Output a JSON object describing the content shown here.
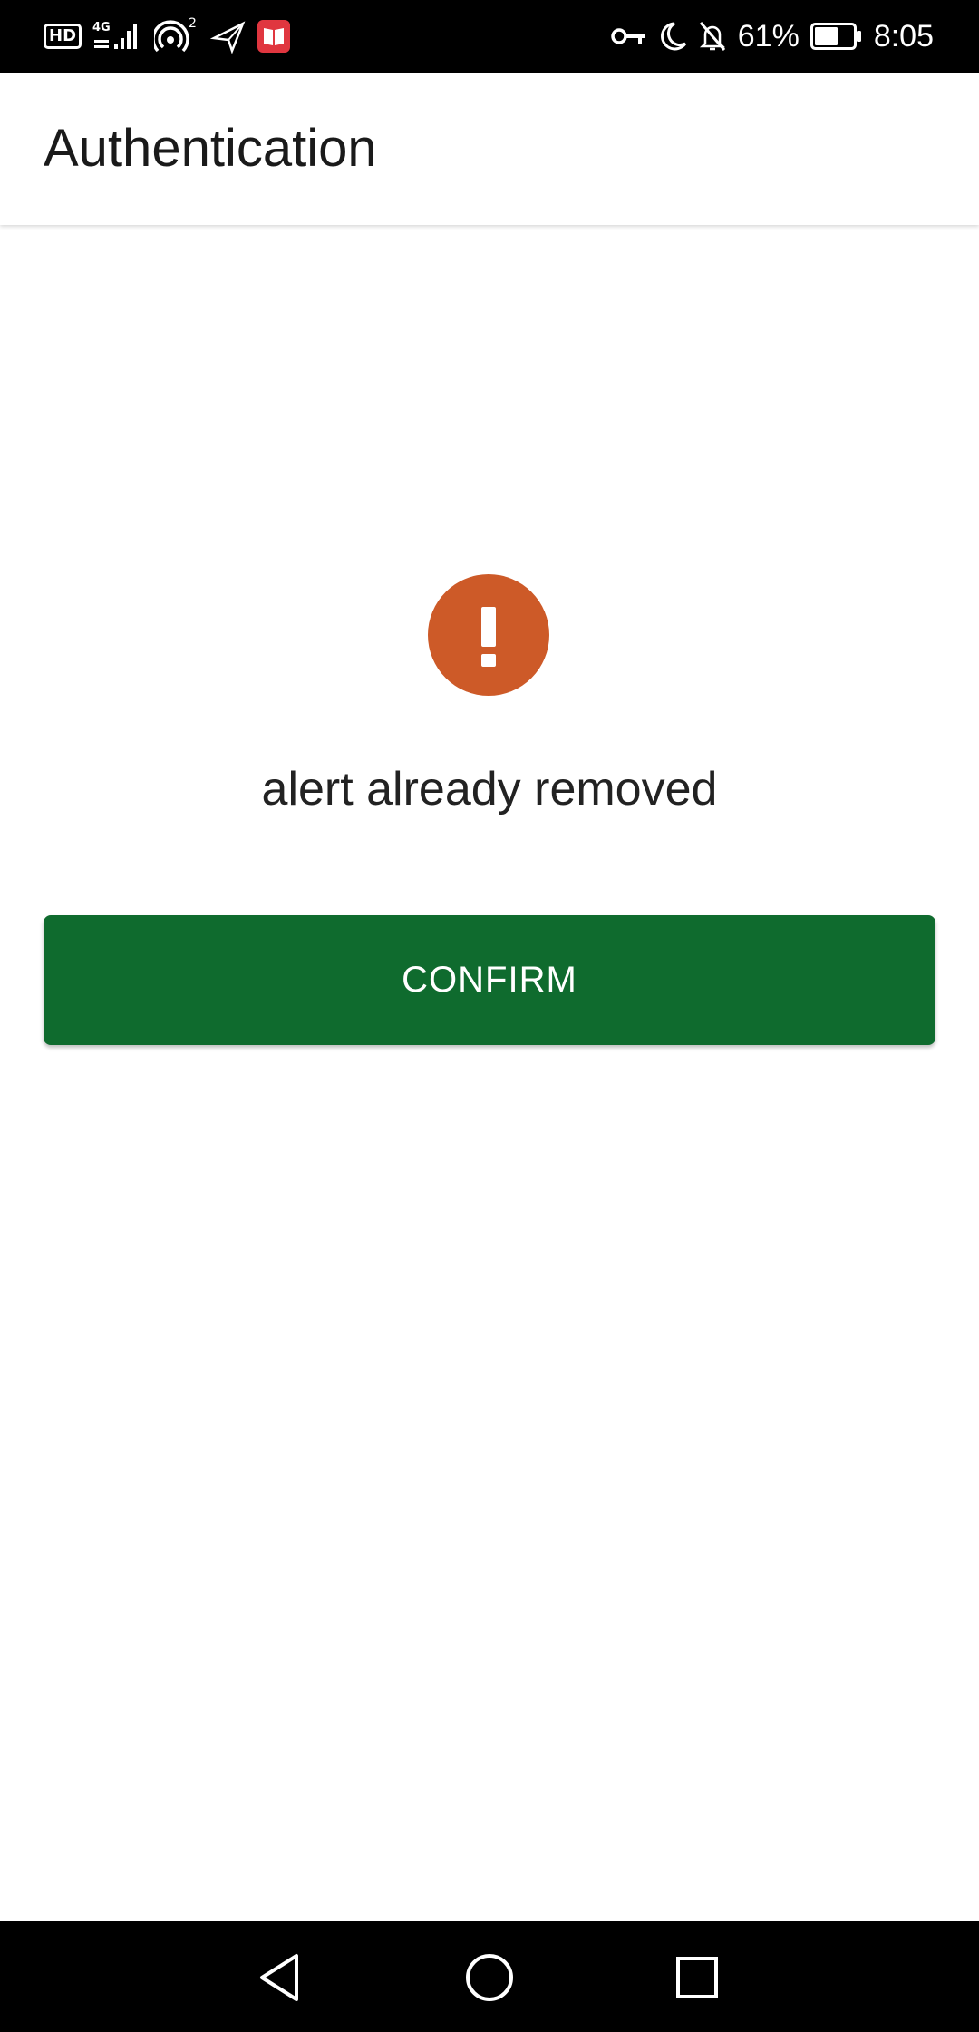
{
  "status_bar": {
    "left_icons": [
      "hd-badge",
      "signal-4g-icon",
      "hotspot-icon",
      "airplane-icon",
      "book-app-icon"
    ],
    "hd_label": "HD",
    "network_label": "4G",
    "hotspot_count": "2",
    "right_icons": [
      "vpn-key-icon",
      "do-not-disturb-icon",
      "mute-icon",
      "battery-icon"
    ],
    "battery_percent": "61%",
    "battery_level": 0.61,
    "time": "8:05"
  },
  "app_bar": {
    "title": "Authentication"
  },
  "alert": {
    "icon": "exclamation-alert-icon",
    "icon_color": "#cd5a28",
    "message": "alert already removed"
  },
  "confirm_button": {
    "label": "CONFIRM",
    "color": "#0f6b2e"
  },
  "nav_bar": {
    "buttons": [
      "back-triangle-icon",
      "home-circle-icon",
      "recents-square-icon"
    ]
  }
}
